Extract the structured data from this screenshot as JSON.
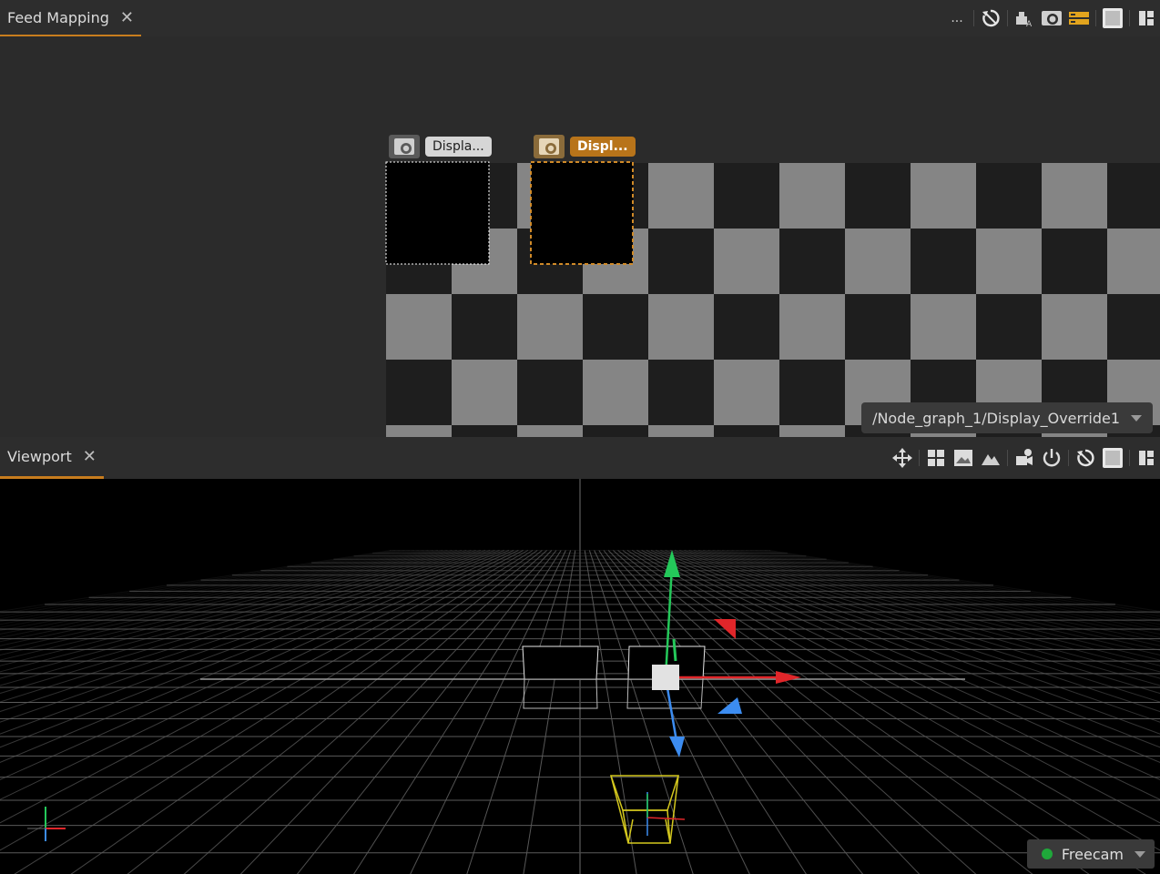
{
  "feed_mapping": {
    "tab_title": "Feed Mapping",
    "close_glyph": "✕",
    "toolbar_more": "...",
    "display_left_label": "Displa...",
    "display_right_label": "Displ...",
    "node_path": "/Node_graph_1/Display_Override1"
  },
  "viewport": {
    "tab_title": "Viewport",
    "close_glyph": "✕",
    "camera_mode": "Freecam"
  },
  "colors": {
    "accent": "#c87d1e",
    "axis_x": "#e0262a",
    "axis_y": "#24c85a",
    "axis_z": "#3c8cf0",
    "camera_wire": "#d4c81e",
    "checker_light": "#858585",
    "checker_dark": "#1e1e1e"
  }
}
